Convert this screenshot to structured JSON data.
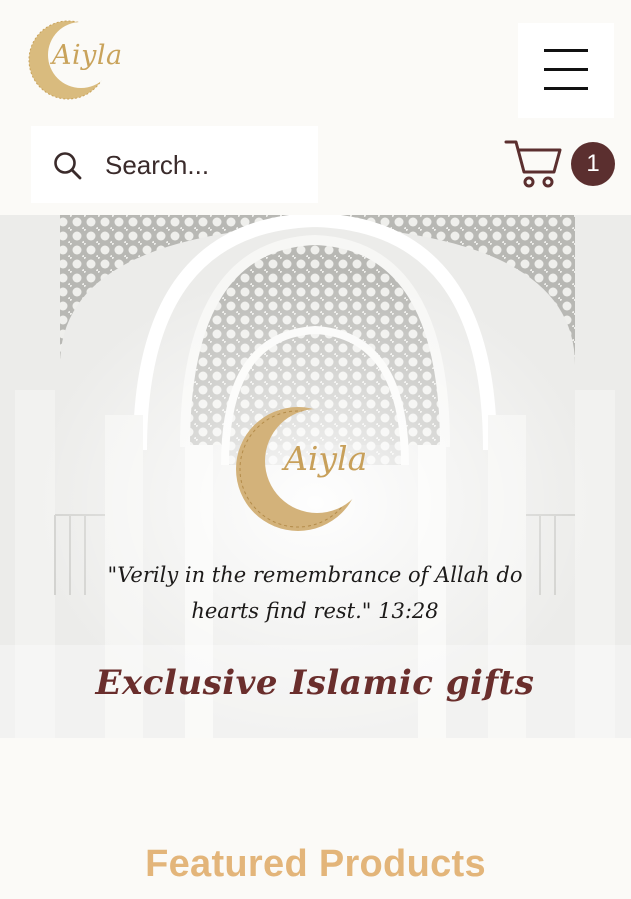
{
  "header": {
    "logo_text": "Aiyla",
    "menu_label": "menu",
    "search": {
      "placeholder": "Search..."
    },
    "cart": {
      "count": "1"
    }
  },
  "hero": {
    "logo_text": "Aiyla",
    "quote_line1": "\"Verily in the remembrance of Allah do",
    "quote_line2": "hearts find rest.\" 13:28",
    "tagline": "Exclusive Islamic gifts"
  },
  "featured": {
    "title": "Featured Products"
  },
  "colors": {
    "gold": "#c9a35b",
    "brand_brown": "#5b2f2f",
    "featured_title": "#e3b57a",
    "background": "#fbfaf7"
  },
  "icons": {
    "menu": "hamburger-icon",
    "search": "search-icon",
    "cart": "cart-icon",
    "logo": "crescent-moon-icon"
  }
}
